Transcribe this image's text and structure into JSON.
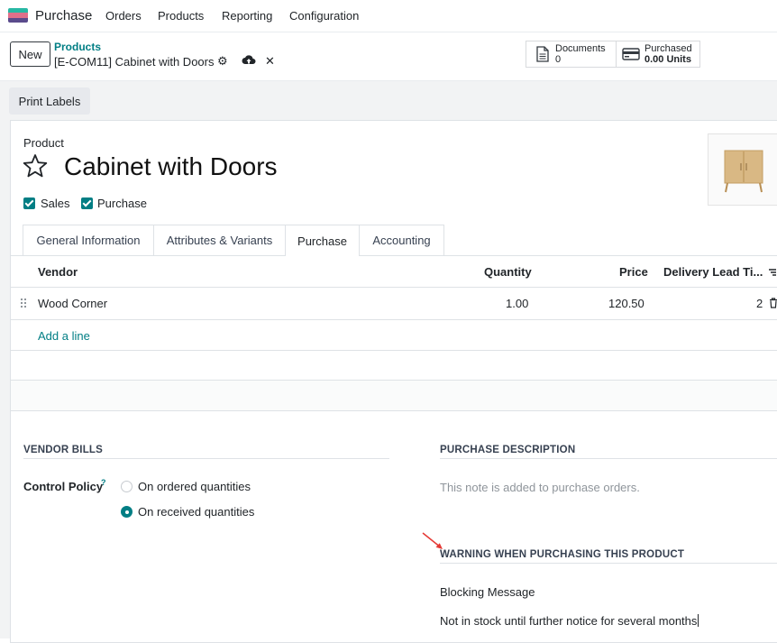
{
  "topnav": {
    "app_name": "Purchase",
    "menu": [
      "Orders",
      "Products",
      "Reporting",
      "Configuration"
    ]
  },
  "control_panel": {
    "new_label": "New",
    "breadcrumb_parent": "Products",
    "breadcrumb_current": "[E-COM11] Cabinet with Doors",
    "stats": {
      "documents_label": "Documents",
      "documents_value": "0",
      "purchased_label": "Purchased",
      "purchased_value": "0.00 Units"
    }
  },
  "actions": {
    "print_labels": "Print Labels"
  },
  "product": {
    "label": "Product",
    "name": "Cabinet with Doors",
    "sales_label": "Sales",
    "purchase_label": "Purchase",
    "sales_checked": true,
    "purchase_checked": true
  },
  "tabs": [
    {
      "label": "General Information",
      "active": false
    },
    {
      "label": "Attributes & Variants",
      "active": false
    },
    {
      "label": "Purchase",
      "active": true
    },
    {
      "label": "Accounting",
      "active": false
    }
  ],
  "vendor_table": {
    "headers": [
      "Vendor",
      "Quantity",
      "Price",
      "Delivery Lead Ti..."
    ],
    "rows": [
      {
        "vendor": "Wood Corner",
        "quantity": "1.00",
        "price": "120.50",
        "lead_time": "2"
      }
    ],
    "add_line": "Add a line"
  },
  "vendor_bills": {
    "title": "VENDOR BILLS",
    "control_policy_label": "Control Policy",
    "help_mark": "?",
    "options": [
      {
        "label": "On ordered quantities",
        "selected": false
      },
      {
        "label": "On received quantities",
        "selected": true
      }
    ]
  },
  "purchase_description": {
    "title": "PURCHASE DESCRIPTION",
    "placeholder": "This note is added to purchase orders."
  },
  "warning": {
    "title": "WARNING WHEN PURCHASING THIS PRODUCT",
    "level": "Blocking Message",
    "message": "Not in stock until further notice for several months"
  },
  "colors": {
    "accent": "#017e84",
    "annotation_arrow": "#e53935",
    "logo": [
      "#1ab394",
      "#e46e78",
      "#5b4a8b"
    ]
  }
}
